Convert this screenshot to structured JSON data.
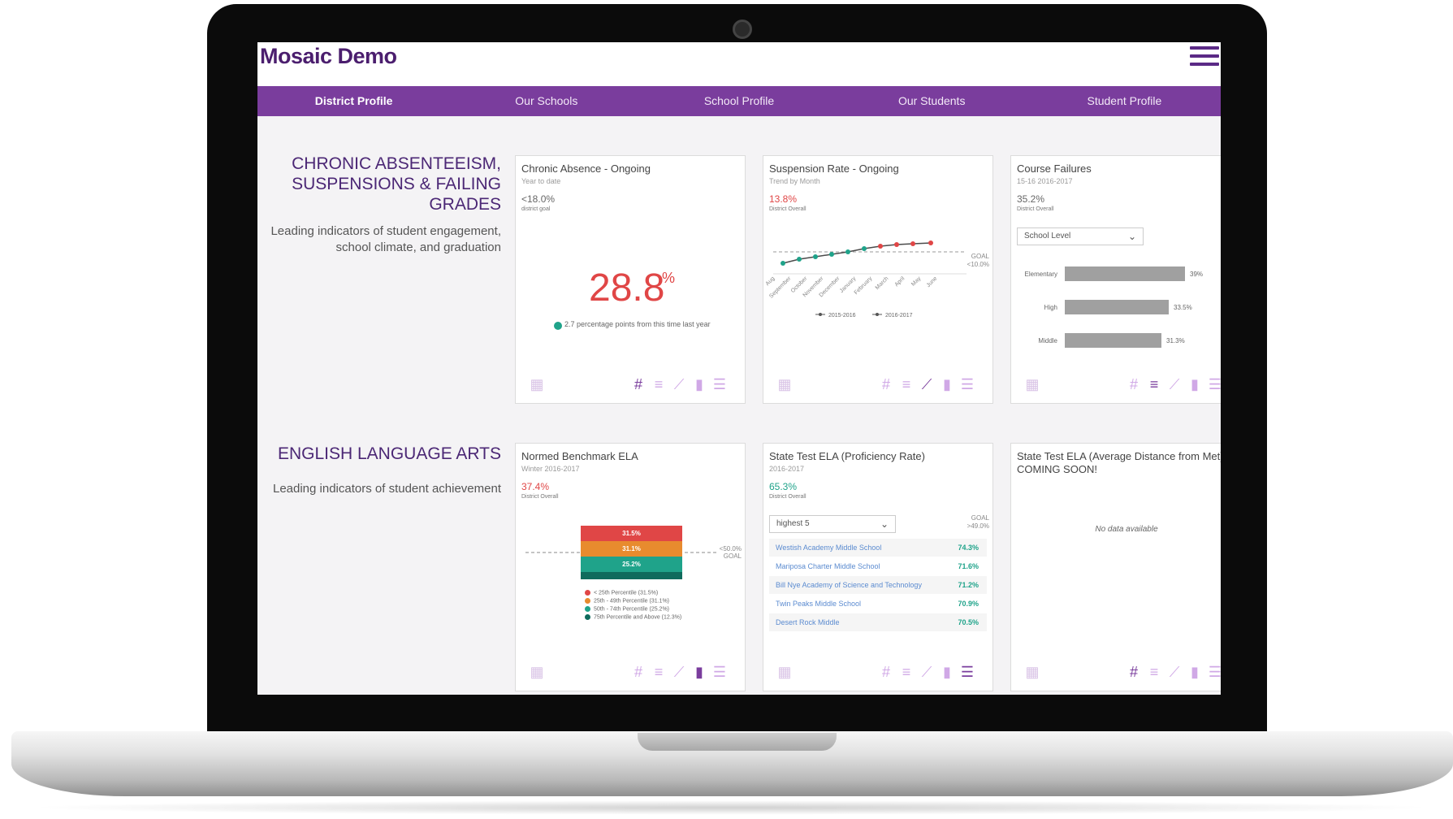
{
  "app": {
    "title": "Mosaic Demo"
  },
  "nav": [
    {
      "label": "District Profile",
      "active": true
    },
    {
      "label": "Our Schools",
      "active": false
    },
    {
      "label": "School Profile",
      "active": false
    },
    {
      "label": "Our Students",
      "active": false
    },
    {
      "label": "Student Profile",
      "active": false
    }
  ],
  "sections": [
    {
      "title": "CHRONIC ABSENTEEISM, SUSPENSIONS & FAILING GRADES",
      "description": "Leading indicators of student engagement, school climate, and graduation"
    },
    {
      "title": "ENGLISH LANGUAGE ARTS",
      "description": "Leading indicators of student achievement"
    }
  ],
  "cards": {
    "chronic_absence": {
      "title": "Chronic Absence - Ongoing",
      "subtitle": "Year to date",
      "metric": "<18.0%",
      "metric_label": "district goal",
      "big_value": "28.8",
      "big_unit": "%",
      "change_text": "2.7 percentage points from this time last year"
    },
    "suspension_rate": {
      "title": "Suspension Rate - Ongoing",
      "subtitle": "Trend by Month",
      "metric": "13.8%",
      "metric_label": "District Overall",
      "goal_label": "GOAL",
      "goal_value": "<10.0%",
      "months": [
        "Aug",
        "September",
        "October",
        "November",
        "December",
        "January",
        "February",
        "March",
        "April",
        "May",
        "June"
      ],
      "legend": [
        "2015-2016",
        "2016-2017"
      ]
    },
    "course_failures": {
      "title": "Course Failures",
      "subtitle": "15-16 2016-2017",
      "metric": "35.2%",
      "metric_label": "District Overall",
      "dropdown": "School Level",
      "bars": [
        {
          "label": "Elementary",
          "value": "39%"
        },
        {
          "label": "High",
          "value": "33.5%"
        },
        {
          "label": "Middle",
          "value": "31.3%"
        }
      ]
    },
    "normed_benchmark": {
      "title": "Normed Benchmark ELA",
      "subtitle": "Winter 2016-2017",
      "metric": "37.4%",
      "metric_label": "District Overall",
      "goal_value": "<50.0%",
      "goal_label": "GOAL",
      "segments": [
        "31.5%",
        "31.1%",
        "25.2%"
      ],
      "legend": [
        "< 25th Percentile (31.5%)",
        "25th - 49th Percentile (31.1%)",
        "50th - 74th Percentile (25.2%)",
        "75th Percentile and Above (12.3%)"
      ]
    },
    "state_test_ela": {
      "title": "State Test ELA (Proficiency Rate)",
      "subtitle": "2016-2017",
      "metric": "65.3%",
      "metric_label": "District Overall",
      "dropdown": "highest 5",
      "goal_label": "GOAL",
      "goal_value": ">49.0%",
      "rows": [
        {
          "name": "Westish Academy Middle School",
          "value": "74.3%"
        },
        {
          "name": "Mariposa Charter Middle School",
          "value": "71.6%"
        },
        {
          "name": "Bill Nye Academy of Science and Technology",
          "value": "71.2%"
        },
        {
          "name": "Twin Peaks Middle School",
          "value": "70.9%"
        },
        {
          "name": "Desert Rock Middle",
          "value": "70.5%"
        }
      ]
    },
    "state_test_avg": {
      "title": "State Test ELA (Average Distance from Met)",
      "subtitle": "COMING SOON!",
      "empty_text": "No data available"
    }
  },
  "colors": {
    "brand_purple": "#7a3d9d",
    "title_purple": "#4b1e6e",
    "alert_red": "#e04646",
    "teal": "#1fa38a",
    "orange": "#e88b2e",
    "dark_teal": "#0f6b5d"
  },
  "icons": {
    "toolbar": [
      "hash-icon",
      "bar-list-icon",
      "line-chart-icon",
      "column-chart-icon",
      "list-icon"
    ],
    "chart_placeholder": "chart-grid-icon"
  }
}
